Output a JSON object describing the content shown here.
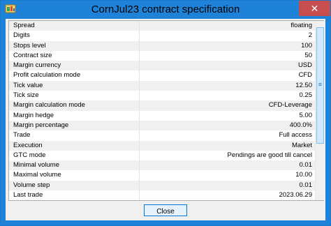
{
  "window": {
    "title": "CornJul23 contract specification",
    "close_glyph": "✕"
  },
  "rows": [
    {
      "name": "Spread",
      "value": "floating"
    },
    {
      "name": "Digits",
      "value": "2"
    },
    {
      "name": "Stops level",
      "value": "100"
    },
    {
      "name": "Contract size",
      "value": "50"
    },
    {
      "name": "Margin currency",
      "value": "USD"
    },
    {
      "name": "Profit calculation mode",
      "value": "CFD"
    },
    {
      "name": "Tick value",
      "value": "12.50"
    },
    {
      "name": "Tick size",
      "value": "0.25"
    },
    {
      "name": "Margin calculation mode",
      "value": "CFD-Leverage"
    },
    {
      "name": "Margin hedge",
      "value": "5.00"
    },
    {
      "name": "Margin percentage",
      "value": "400.0%"
    },
    {
      "name": "Trade",
      "value": "Full access"
    },
    {
      "name": "Execution",
      "value": "Market"
    },
    {
      "name": "GTC mode",
      "value": "Pendings are good till cancel"
    },
    {
      "name": "Minimal volume",
      "value": "0.01"
    },
    {
      "name": "Maximal volume",
      "value": "10.00"
    },
    {
      "name": "Volume step",
      "value": "0.01"
    },
    {
      "name": "Last trade",
      "value": "2023.06.29"
    }
  ],
  "scrollbar": {
    "grip_glyph": "≡"
  },
  "footer": {
    "close_label": "Close"
  }
}
